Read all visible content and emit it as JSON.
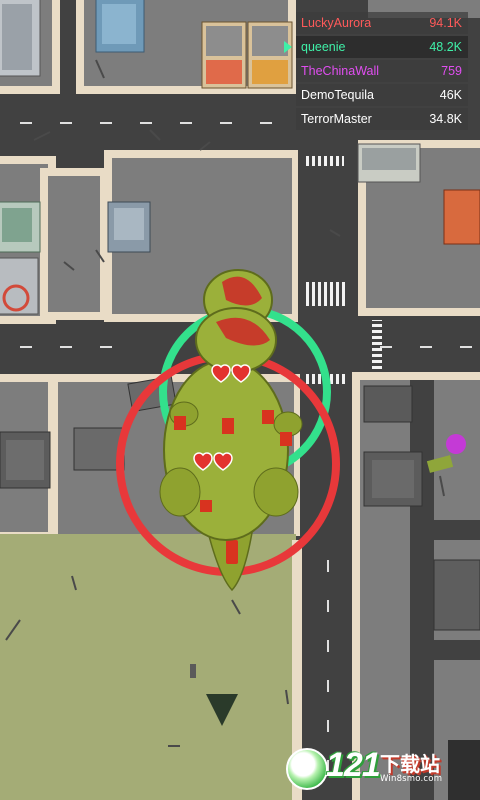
{
  "leaderboard": [
    {
      "name": "LuckyAurora",
      "score": "94.1K",
      "name_color": "#ff5a5a",
      "score_color": "#ff5a5a",
      "is_player": false
    },
    {
      "name": "queenie",
      "score": "48.2K",
      "name_color": "#3ff0a8",
      "score_color": "#3ff0a8",
      "is_player": true
    },
    {
      "name": "TheChinaWall",
      "score": "759",
      "name_color": "#e04ef0",
      "score_color": "#e04ef0",
      "is_player": false
    },
    {
      "name": "DemoTequila",
      "score": "46K",
      "name_color": "#ffffff",
      "score_color": "#ffffff",
      "is_player": false
    },
    {
      "name": "TerrorMaster",
      "score": "34.8K",
      "name_color": "#ffffff",
      "score_color": "#ffffff",
      "is_player": false
    }
  ],
  "player_marker": {
    "icon": "triangle-pointer-icon",
    "color": "#3ff0a8"
  },
  "watermark": {
    "number": "121",
    "text_cn": "下载站",
    "url": "Win8smo.com"
  },
  "colors": {
    "road": "#3f3f3f",
    "block": "#7d7d7d",
    "sidewalk": "#e9dcc6",
    "park": "#a4ac76",
    "green_ring": "#33e08c",
    "red_ring": "#e8383a",
    "monster": "#99ad34"
  },
  "monster_health": {
    "hearts_shown": 4,
    "icon": "heart-icon"
  }
}
